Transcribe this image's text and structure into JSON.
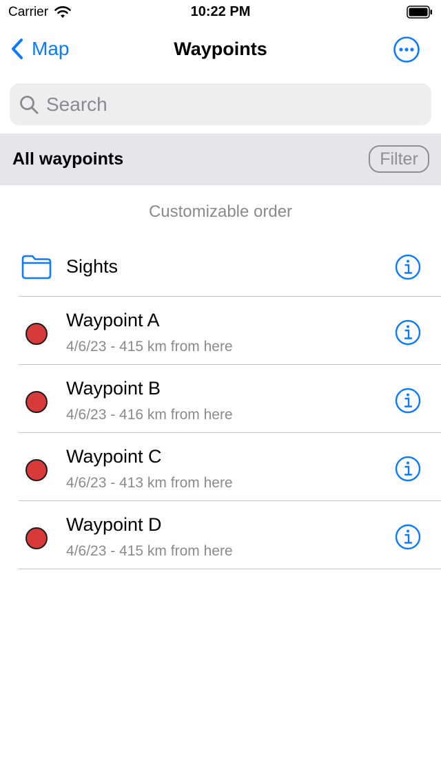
{
  "status_bar": {
    "carrier": "Carrier",
    "time": "10:22 PM"
  },
  "nav": {
    "back_label": "Map",
    "title": "Waypoints"
  },
  "search": {
    "placeholder": "Search",
    "value": ""
  },
  "section": {
    "title": "All waypoints",
    "filter_label": "Filter"
  },
  "order_note": "Customizable order",
  "folder": {
    "label": "Sights"
  },
  "waypoints": [
    {
      "name": "Waypoint A",
      "subtitle": "4/6/23 - 415 km from here"
    },
    {
      "name": "Waypoint B",
      "subtitle": "4/6/23 - 416 km from here"
    },
    {
      "name": "Waypoint C",
      "subtitle": "4/6/23 - 413 km from here"
    },
    {
      "name": "Waypoint D",
      "subtitle": "4/6/23 - 415 km from here"
    }
  ],
  "colors": {
    "accent": "#0a7aff",
    "waypoint_dot": "#d83a3a",
    "secondary_text": "#8a8a8e",
    "section_bg": "#e5e5ea"
  },
  "icons": {
    "back": "chevron-left-icon",
    "more": "ellipsis-circle-icon",
    "search": "magnifier-icon",
    "folder": "folder-icon",
    "info": "info-circle-icon"
  }
}
